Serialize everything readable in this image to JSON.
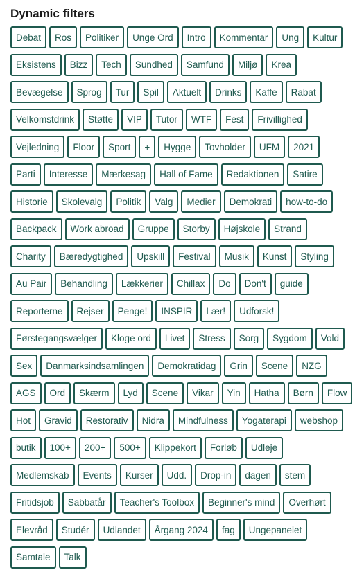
{
  "title": "Dynamic filters",
  "rows": [
    [
      "Debat",
      "Ros",
      "Politiker",
      "Unge Ord",
      "Intro",
      "Kommentar",
      "Ung",
      "Kultur"
    ],
    [
      "Eksistens",
      "Bizz",
      "Tech",
      "Sundhed",
      "Samfund",
      "Miljø",
      "Krea"
    ],
    [
      "Bevægelse",
      "Sprog",
      "Tur",
      "Spil",
      "Aktuelt",
      "Drinks",
      "Kaffe",
      "Rabat"
    ],
    [
      "Velkomstdrink",
      "Støtte",
      "VIP",
      "Tutor",
      "WTF",
      "Fest",
      "Frivillighed"
    ],
    [
      "Vejledning",
      "Floor",
      "Sport",
      "+",
      "Hygge",
      "Tovholder",
      "UFM",
      "2021"
    ],
    [
      "Parti",
      "Interesse",
      "Mærkesag",
      "Hall of Fame",
      "Redaktionen",
      "Satire"
    ],
    [
      "Historie",
      "Skolevalg",
      "Politik",
      "Valg",
      "Medier",
      "Demokrati",
      "how-to-do"
    ],
    [
      "Backpack",
      "Work abroad",
      "Gruppe",
      "Storby",
      "Højskole",
      "Strand"
    ],
    [
      "Charity",
      "Bæredygtighed",
      "Upskill",
      "Festival",
      "Musik",
      "Kunst",
      "Styling"
    ],
    [
      "Au Pair",
      "Behandling",
      "Lækkerier",
      "Chillax",
      "Do",
      "Don't",
      "guide"
    ],
    [
      "Reporterne",
      "Rejser",
      "Penge!",
      "INSPIR",
      "Lær!",
      "Udforsk!"
    ],
    [
      "Førstegangsvælger",
      "Kloge ord",
      "Livet",
      "Stress",
      "Sorg",
      "Sygdom",
      "Vold"
    ],
    [
      "Sex",
      "Danmarksindsamlingen",
      "Demokratidag",
      "Grin",
      "Scene",
      "NZG"
    ],
    [
      "AGS",
      "Ord",
      "Skærm",
      "Lyd",
      "Scene",
      "Vikar",
      "Yin",
      "Hatha",
      "Børn",
      "Flow"
    ],
    [
      "Hot",
      "Gravid",
      "Restorativ",
      "Nidra",
      "Mindfulness",
      "Yogaterapi",
      "webshop"
    ],
    [
      "butik",
      "100+",
      "200+",
      "500+",
      "Klippekort",
      "Forløb",
      "Udleje"
    ],
    [
      "Medlemskab",
      "Events",
      "Kurser",
      "Udd.",
      "Drop-in",
      "dagen",
      "stem"
    ],
    [
      "Fritidsjob",
      "Sabbatår",
      "Teacher's Toolbox",
      "Beginner's mind",
      "Overhørt"
    ],
    [
      "Elevråd",
      "Studér",
      "Udlandet",
      "Årgang 2024",
      "fag",
      "Ungepanelet"
    ],
    [
      "Samtale",
      "Talk"
    ]
  ]
}
